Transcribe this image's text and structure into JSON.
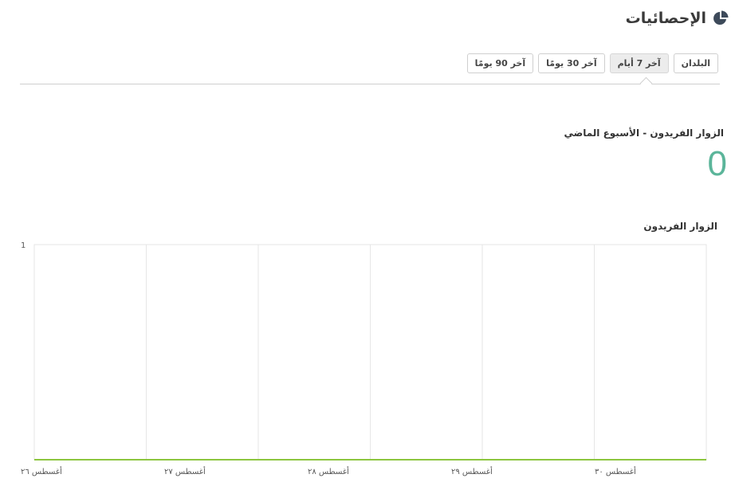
{
  "header": {
    "title": "الإحصائيات",
    "icon": "pie-chart-icon"
  },
  "tabs": [
    {
      "label": "البلدان",
      "active": false
    },
    {
      "label": "آخر 7 أيام",
      "active": true
    },
    {
      "label": "آخر 30 يومًا",
      "active": false
    },
    {
      "label": "آخر 90 يومًا",
      "active": false
    }
  ],
  "stat": {
    "label": "الزوار الفريدون - الأسبوع الماضي",
    "value": "0"
  },
  "colors": {
    "accent": "#5bb59a",
    "line": "#8cc63f",
    "grid": "#e6e6e6"
  },
  "chart_data": {
    "type": "line",
    "title": "الزوار الفريدون",
    "xlabel": "",
    "ylabel": "",
    "categories": [
      "أغسطس ٢٦",
      "أغسطس ٢٧",
      "أغسطس ٢٨",
      "أغسطس ٢٩",
      "أغسطس ٣٠"
    ],
    "series": [
      {
        "values": [
          0,
          0,
          0,
          0,
          0,
          0,
          0
        ]
      }
    ],
    "ylim": [
      0,
      1
    ],
    "y_ticks": [
      "1"
    ],
    "grid": true,
    "legend": "none"
  }
}
